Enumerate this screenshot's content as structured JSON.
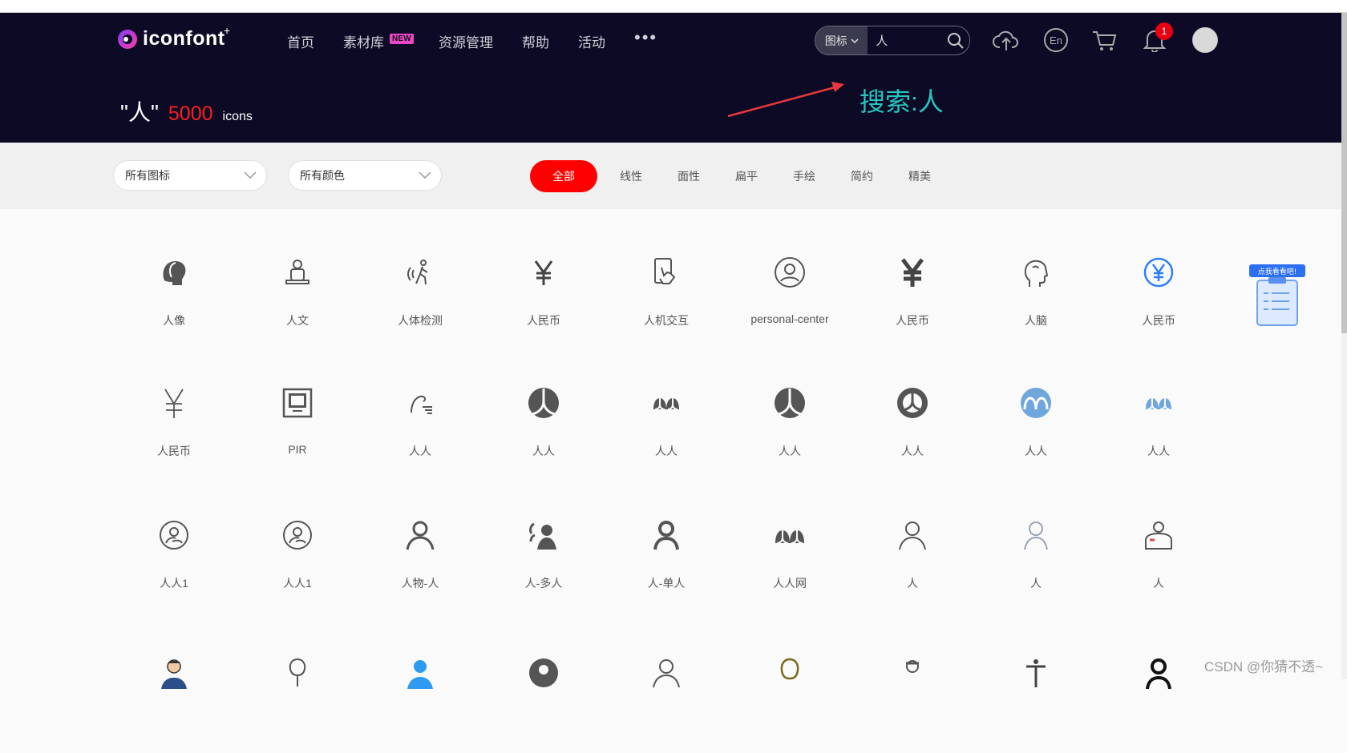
{
  "header": {
    "logo_text": "iconfont",
    "logo_plus": "+",
    "nav": [
      "首页",
      "素材库",
      "资源管理",
      "帮助",
      "活动"
    ],
    "badge_new": "NEW",
    "more": "•••",
    "search_type": "图标",
    "search_value": "人",
    "notification_count": "1"
  },
  "result": {
    "query": "\"人\"",
    "count": "5000",
    "unit": "icons"
  },
  "annotation": {
    "text": "搜索:人",
    "color": "#28c5c0"
  },
  "filters": {
    "dropdown_icons": "所有图标",
    "dropdown_colors": "所有颜色",
    "tabs": [
      "全部",
      "线性",
      "面性",
      "扁平",
      "手绘",
      "简约",
      "精美"
    ],
    "active_tab": "全部"
  },
  "icons": [
    {
      "label": "人像",
      "icon": "profile-head-icon"
    },
    {
      "label": "人文",
      "icon": "humanities-icon"
    },
    {
      "label": "人体检测",
      "icon": "body-detection-icon"
    },
    {
      "label": "人民币",
      "icon": "rmb-icon"
    },
    {
      "label": "人机交互",
      "icon": "touch-interaction-icon"
    },
    {
      "label": "personal-center",
      "icon": "user-circle-icon"
    },
    {
      "label": "人民币",
      "icon": "rmb-bold-icon"
    },
    {
      "label": "人脑",
      "icon": "brain-head-icon"
    },
    {
      "label": "人民币",
      "icon": "rmb-circle-icon"
    },
    {
      "label": "人民币",
      "icon": "rmb-thin-icon"
    },
    {
      "label": "PIR",
      "icon": "pir-sensor-icon"
    },
    {
      "label": "人人",
      "icon": "renren-line-icon"
    },
    {
      "label": "人人",
      "icon": "renren-circle-icon"
    },
    {
      "label": "人人",
      "icon": "renren-mark-icon"
    },
    {
      "label": "人人",
      "icon": "renren-circle-icon"
    },
    {
      "label": "人人",
      "icon": "renren-badge-icon"
    },
    {
      "label": "人人",
      "icon": "renren-blue-circle-icon"
    },
    {
      "label": "人人",
      "icon": "renren-blue-mark-icon"
    },
    {
      "label": "人人1",
      "icon": "renren-ring-icon"
    },
    {
      "label": "人人1",
      "icon": "renren-ring-icon"
    },
    {
      "label": "人物-人",
      "icon": "person-icon"
    },
    {
      "label": "人-多人",
      "icon": "multi-person-icon"
    },
    {
      "label": "人-单人",
      "icon": "single-person-icon"
    },
    {
      "label": "人人网",
      "icon": "renren-net-icon"
    },
    {
      "label": "人",
      "icon": "person-outline-icon"
    },
    {
      "label": "人",
      "icon": "person-light-icon"
    },
    {
      "label": "人",
      "icon": "person-badge-icon"
    }
  ],
  "watermark": "CSDN @你猜不透~",
  "colors": {
    "header_bg": "#0c0a25",
    "accent": "#ff0000",
    "blue": "#2d7ff9",
    "light_blue": "#6fa7dd"
  }
}
